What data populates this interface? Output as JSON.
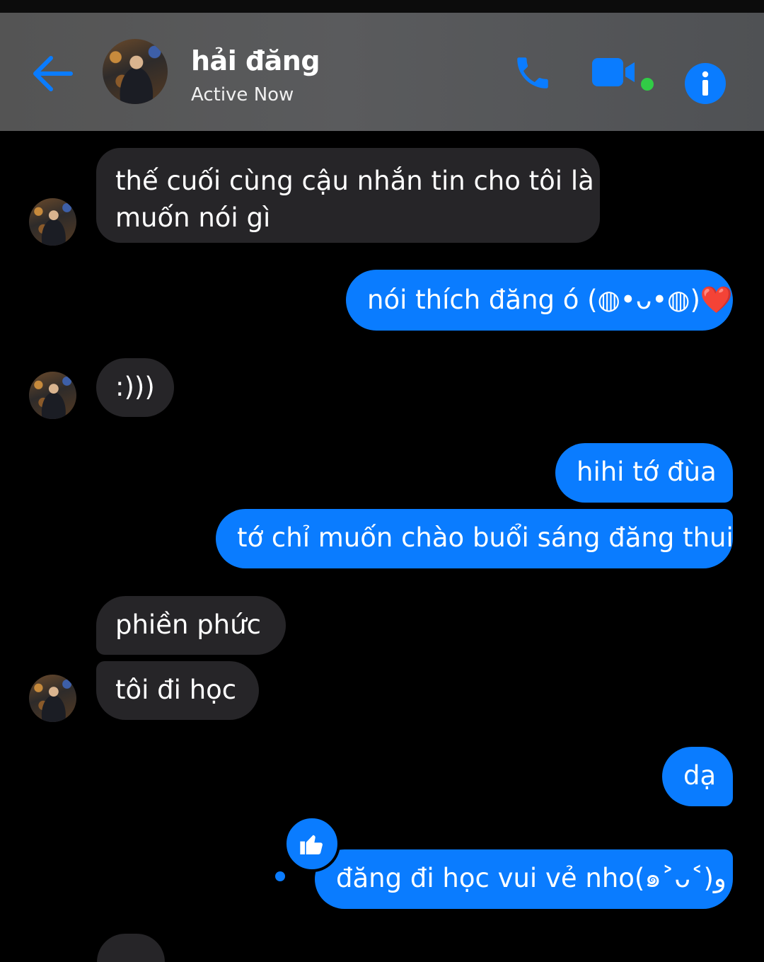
{
  "header": {
    "contact_name": "hải đăng",
    "status": "Active Now",
    "icons": {
      "back": "arrow-left-icon",
      "call": "phone-icon",
      "video": "video-camera-icon",
      "info": "info-icon"
    },
    "accent_color": "#0a7cff",
    "online_color": "#31cc46"
  },
  "messages": [
    {
      "side": "in",
      "text_lines": [
        "thế cuối cùng cậu nhắn tin cho tôi là",
        "muốn nói gì"
      ]
    },
    {
      "side": "out",
      "text": "nói thích đăng ó (◍•ᴗ•◍)❤️"
    },
    {
      "side": "in",
      "text": ":)))"
    },
    {
      "side": "out",
      "text": "hihi tớ đùa"
    },
    {
      "side": "out",
      "text": "tớ chỉ muốn chào buổi sáng đăng thui"
    },
    {
      "side": "in",
      "text": "phiền phức"
    },
    {
      "side": "in",
      "text": "tôi đi học"
    },
    {
      "side": "out",
      "text": "dạ"
    },
    {
      "side": "out",
      "text": "đăng đi học vui vẻ nho(๑˃ᴗ˂)ﻭ",
      "reaction": "thumbs-up-icon"
    }
  ],
  "colors": {
    "incoming_bubble": "#262528",
    "outgoing_bubble": "#0a7cff",
    "background": "#000000"
  }
}
